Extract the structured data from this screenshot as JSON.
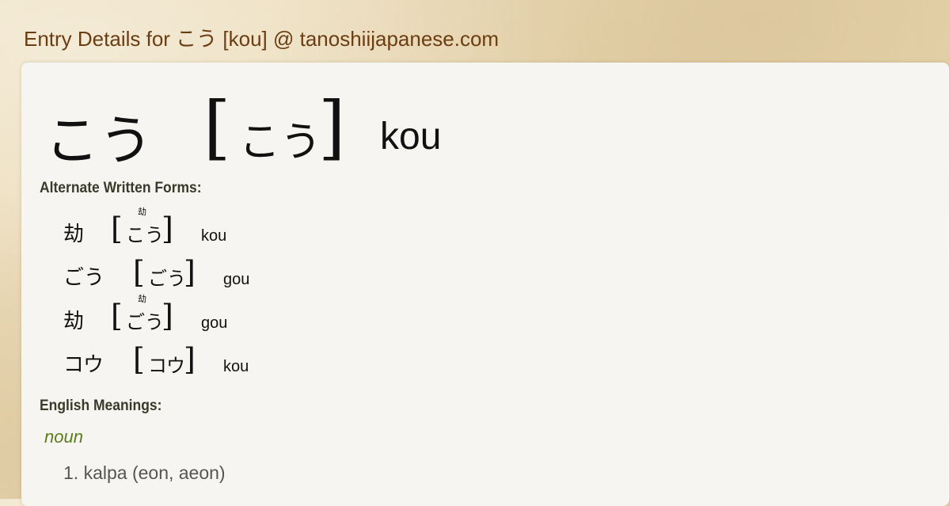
{
  "header": {
    "title": "Entry Details for こう [kou] @ tanoshiijapanese.com"
  },
  "entry": {
    "word": "こう",
    "reading": "こう",
    "bracket_open": "[",
    "bracket_close": "]",
    "romaji": "kou"
  },
  "alternate_forms": {
    "label": "Alternate Written Forms:",
    "items": [
      {
        "word": "劫",
        "reading": "こう",
        "ruby": "劫",
        "romaji": "kou"
      },
      {
        "word": "ごう",
        "reading": "ごう",
        "ruby": "",
        "romaji": "gou"
      },
      {
        "word": "劫",
        "reading": "ごう",
        "ruby": "劫",
        "romaji": "gou"
      },
      {
        "word": "コウ",
        "reading": "コウ",
        "ruby": "",
        "romaji": "kou"
      }
    ]
  },
  "meanings": {
    "label": "English Meanings:",
    "part_of_speech": "noun",
    "items": [
      {
        "text": "1. kalpa (eon, aeon)"
      }
    ]
  },
  "colors": {
    "header_text": "#6b3d12",
    "pos_text": "#5a7d1e",
    "card_background": "#f6f5f1",
    "page_background": "#ecdcb8"
  }
}
